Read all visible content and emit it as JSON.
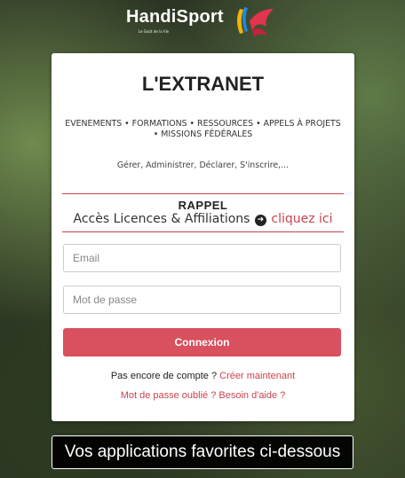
{
  "logo": {
    "name": "HandiSport",
    "tagline": "Le Goût de la Vie"
  },
  "card": {
    "title": "L'EXTRANET",
    "subtitle": "EVENEMENTS • FORMATIONS • RESSOURCES • APPELS À PROJETS • MISSIONS FÉDÉRALES",
    "tagline": "Gérer, Administrer, Déclarer, S'inscrire,..."
  },
  "rappel": {
    "title": "RAPPEL",
    "text": "Accès Licences & Affiliations",
    "link": "cliquez ici"
  },
  "form": {
    "email_placeholder": "Email",
    "password_placeholder": "Mot de passe",
    "submit_label": "Connexion"
  },
  "signup": {
    "question": "Pas encore de compte ?",
    "link": "Créer maintenant"
  },
  "help": {
    "forgot_link": "Mot de passe oublié ?",
    "help_link": "Besoin d'aide ?"
  },
  "favorites": {
    "label": "Vos applications favorites ci-dessous"
  },
  "colors": {
    "accent": "#d9505e",
    "link": "#c9434f"
  }
}
